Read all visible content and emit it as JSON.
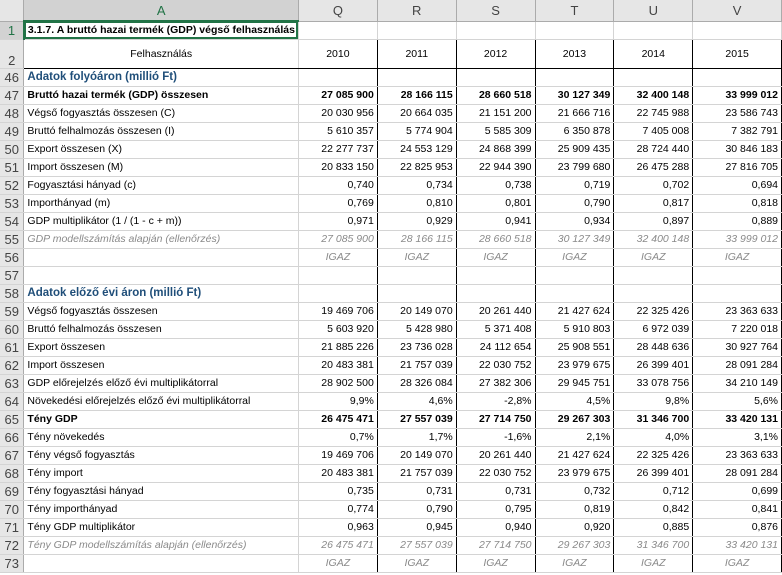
{
  "columns": {
    "A": "A",
    "Q": "Q",
    "R": "R",
    "S": "S",
    "T": "T",
    "U": "U",
    "V": "V"
  },
  "title": "3.1.7. A bruttó hazai termék (GDP) végső felhasználás",
  "header": {
    "label": "Felhasználás",
    "years": [
      "2010",
      "2011",
      "2012",
      "2013",
      "2014",
      "2015"
    ]
  },
  "row_numbers": {
    "r1": "1",
    "r2": "2",
    "r46": "46",
    "r47": "47",
    "r48": "48",
    "r49": "49",
    "r50": "50",
    "r51": "51",
    "r52": "52",
    "r53": "53",
    "r54": "54",
    "r55": "55",
    "r56": "56",
    "r57": "57",
    "r58": "58",
    "r59": "59",
    "r60": "60",
    "r61": "61",
    "r62": "62",
    "r63": "63",
    "r64": "64",
    "r65": "65",
    "r66": "66",
    "r67": "67",
    "r68": "68",
    "r69": "69",
    "r70": "70",
    "r71": "71",
    "r72": "72",
    "r73": "73"
  },
  "rows": {
    "r46": {
      "label": "Adatok folyóáron (millió Ft)"
    },
    "r47": {
      "label": "Bruttó hazai termék (GDP) összesen",
      "v": [
        "27 085 900",
        "28 166 115",
        "28 660 518",
        "30 127 349",
        "32 400 148",
        "33 999 012"
      ]
    },
    "r48": {
      "label": "Végső fogyasztás összesen (C)",
      "v": [
        "20 030 956",
        "20 664 035",
        "21 151 200",
        "21 666 716",
        "22 745 988",
        "23 586 743"
      ]
    },
    "r49": {
      "label": "Bruttó felhalmozás összesen (I)",
      "v": [
        "5 610 357",
        "5 774 904",
        "5 585 309",
        "6 350 878",
        "7 405 008",
        "7 382 791"
      ]
    },
    "r50": {
      "label": "Export összesen (X)",
      "v": [
        "22 277 737",
        "24 553 129",
        "24 868 399",
        "25 909 435",
        "28 724 440",
        "30 846 183"
      ]
    },
    "r51": {
      "label": "Import összesen (M)",
      "v": [
        "20 833 150",
        "22 825 953",
        "22 944 390",
        "23 799 680",
        "26 475 288",
        "27 816 705"
      ]
    },
    "r52": {
      "label": "Fogyasztási hányad (c)",
      "v": [
        "0,740",
        "0,734",
        "0,738",
        "0,719",
        "0,702",
        "0,694"
      ]
    },
    "r53": {
      "label": "Importhányad (m)",
      "v": [
        "0,769",
        "0,810",
        "0,801",
        "0,790",
        "0,817",
        "0,818"
      ]
    },
    "r54": {
      "label": "GDP multiplikátor (1 / (1 - c + m))",
      "v": [
        "0,971",
        "0,929",
        "0,941",
        "0,934",
        "0,897",
        "0,889"
      ]
    },
    "r55": {
      "label": "GDP modellszámítás alapján (ellenőrzés)",
      "v": [
        "27 085 900",
        "28 166 115",
        "28 660 518",
        "30 127 349",
        "32 400 148",
        "33 999 012"
      ]
    },
    "r56": {
      "label": "",
      "v": [
        "IGAZ",
        "IGAZ",
        "IGAZ",
        "IGAZ",
        "IGAZ",
        "IGAZ"
      ]
    },
    "r58": {
      "label": "Adatok előző évi áron (millió Ft)"
    },
    "r59": {
      "label": "Végső fogyasztás összesen",
      "v": [
        "19 469 706",
        "20 149 070",
        "20 261 440",
        "21 427 624",
        "22 325 426",
        "23 363 633"
      ]
    },
    "r60": {
      "label": "Bruttó felhalmozás összesen",
      "v": [
        "5 603 920",
        "5 428 980",
        "5 371 408",
        "5 910 803",
        "6 972 039",
        "7 220 018"
      ]
    },
    "r61": {
      "label": "Export összesen",
      "v": [
        "21 885 226",
        "23 736 028",
        "24 112 654",
        "25 908 551",
        "28 448 636",
        "30 927 764"
      ]
    },
    "r62": {
      "label": "Import összesen",
      "v": [
        "20 483 381",
        "21 757 039",
        "22 030 752",
        "23 979 675",
        "26 399 401",
        "28 091 284"
      ]
    },
    "r63": {
      "label": "GDP előrejelzés előző évi multiplikátorral",
      "v": [
        "28 902 500",
        "28 326 084",
        "27 382 306",
        "29 945 751",
        "33 078 756",
        "34 210 149"
      ]
    },
    "r64": {
      "label": "Növekedési előrejelzés előző évi multiplikátorral",
      "v": [
        "9,9%",
        "4,6%",
        "-2,8%",
        "4,5%",
        "9,8%",
        "5,6%"
      ]
    },
    "r65": {
      "label": "Tény GDP",
      "v": [
        "26 475 471",
        "27 557 039",
        "27 714 750",
        "29 267 303",
        "31 346 700",
        "33 420 131"
      ]
    },
    "r66": {
      "label": "Tény növekedés",
      "v": [
        "0,7%",
        "1,7%",
        "-1,6%",
        "2,1%",
        "4,0%",
        "3,1%"
      ]
    },
    "r67": {
      "label": "Tény végső fogyasztás",
      "v": [
        "19 469 706",
        "20 149 070",
        "20 261 440",
        "21 427 624",
        "22 325 426",
        "23 363 633"
      ]
    },
    "r68": {
      "label": "Tény import",
      "v": [
        "20 483 381",
        "21 757 039",
        "22 030 752",
        "23 979 675",
        "26 399 401",
        "28 091 284"
      ]
    },
    "r69": {
      "label": "Tény fogyasztási hányad",
      "v": [
        "0,735",
        "0,731",
        "0,731",
        "0,732",
        "0,712",
        "0,699"
      ]
    },
    "r70": {
      "label": "Tény importhányad",
      "v": [
        "0,774",
        "0,790",
        "0,795",
        "0,819",
        "0,842",
        "0,841"
      ]
    },
    "r71": {
      "label": "Tény GDP multiplikátor",
      "v": [
        "0,963",
        "0,945",
        "0,940",
        "0,920",
        "0,885",
        "0,876"
      ]
    },
    "r72": {
      "label": "Tény GDP modellszámítás alapján (ellenőrzés)",
      "v": [
        "26 475 471",
        "27 557 039",
        "27 714 750",
        "29 267 303",
        "31 346 700",
        "33 420 131"
      ]
    },
    "r73": {
      "label": "",
      "v": [
        "IGAZ",
        "IGAZ",
        "IGAZ",
        "IGAZ",
        "IGAZ",
        "IGAZ"
      ]
    }
  },
  "colors": {
    "section_text": "#1f4e79",
    "selection": "#217346",
    "header_bg": "#e6e6e6"
  }
}
